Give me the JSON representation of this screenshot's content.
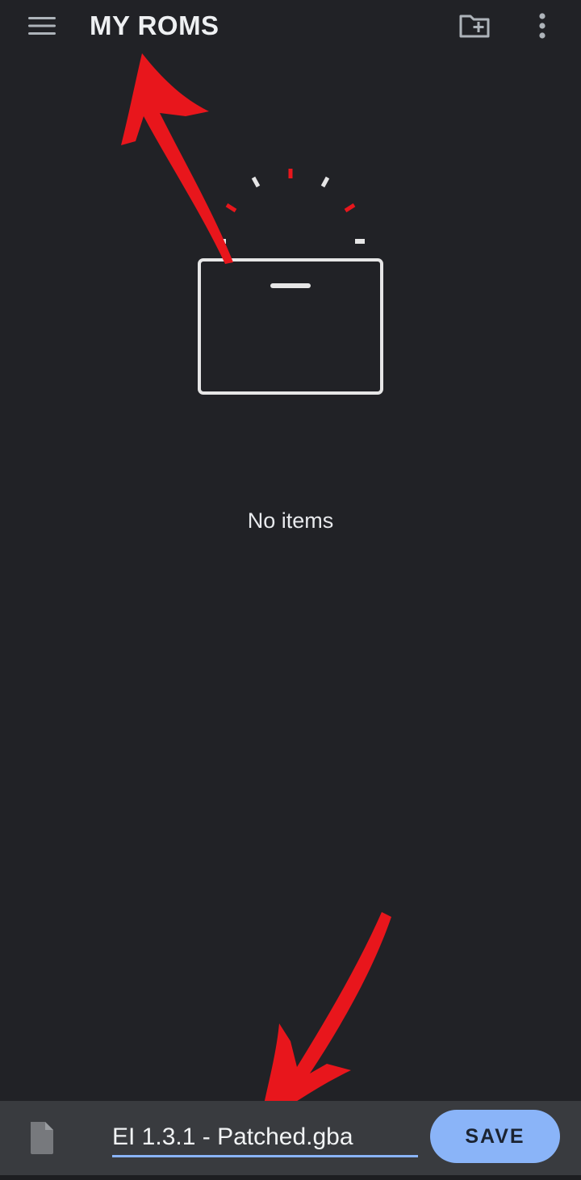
{
  "app": {
    "title": "MY ROMS"
  },
  "toolbar": {
    "menu_icon": "hamburger-menu-icon",
    "new_folder_icon": "create-folder-icon",
    "overflow_icon": "more-vert-icon"
  },
  "empty_state": {
    "message": "No items",
    "illustration": "empty-folder-illustration"
  },
  "save_bar": {
    "file_icon": "file-icon",
    "filename_value": "EI 1.3.1 - Patched.gba",
    "save_label": "SAVE"
  },
  "colors": {
    "background": "#212226",
    "accent": "#8ab4f8",
    "bar": "#393b3f",
    "annotation_arrow": "#e8161c"
  }
}
